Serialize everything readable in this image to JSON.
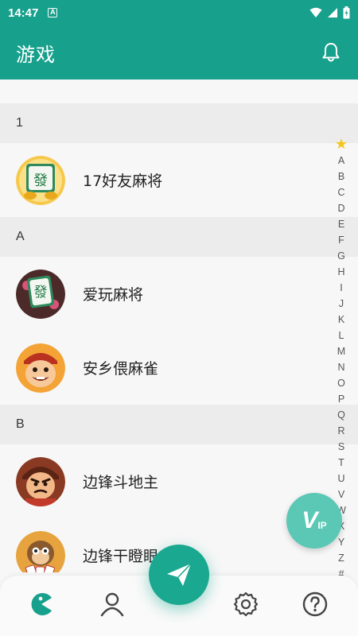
{
  "status_bar": {
    "time": "14:47",
    "badge": "A"
  },
  "app_bar": {
    "title": "游戏"
  },
  "sections": [
    {
      "header": "1",
      "games": [
        {
          "name": "17好友麻将",
          "icon": "mahjong-fa-tile-icon"
        }
      ]
    },
    {
      "header": "A",
      "games": [
        {
          "name": "爱玩麻将",
          "icon": "mahjong-fa-tile-icon"
        },
        {
          "name": "安乡偎麻雀",
          "icon": "cartoon-man-face-icon"
        }
      ]
    },
    {
      "header": "B",
      "games": [
        {
          "name": "边锋斗地主",
          "icon": "cartoon-landlord-face-icon"
        },
        {
          "name": "边锋干瞪眼",
          "icon": "cartoon-monkey-cards-icon"
        }
      ]
    }
  ],
  "index_bar": {
    "star": "★",
    "letters": [
      "A",
      "B",
      "C",
      "D",
      "E",
      "F",
      "G",
      "H",
      "I",
      "J",
      "K",
      "L",
      "M",
      "N",
      "O",
      "P",
      "Q",
      "R",
      "S",
      "T",
      "U",
      "V",
      "W",
      "X",
      "Y",
      "Z",
      "#"
    ]
  },
  "vip_button": {
    "label_v": "V",
    "label_ip": "IP"
  },
  "bottom_nav": {
    "items": [
      "pacman-game-icon",
      "user-icon",
      "send-plane-icon",
      "gear-icon",
      "help-icon"
    ],
    "accent": "#17a08c"
  },
  "colors": {
    "primary": "#17a08c",
    "vip": "#5bc8b6",
    "section_bg": "#ececec"
  }
}
